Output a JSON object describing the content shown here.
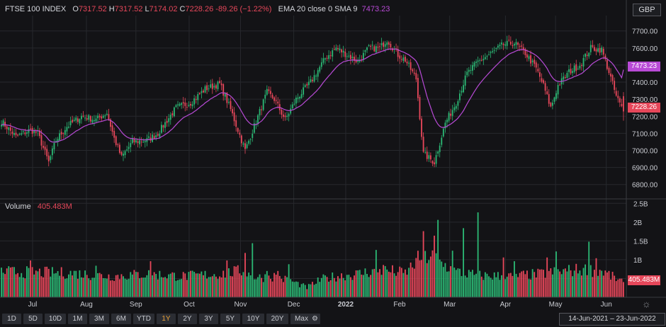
{
  "header": {
    "symbol": "FTSE 100 INDEX",
    "o_label": "O",
    "o_value": "7317.52",
    "h_label": "H",
    "h_value": "7317.52",
    "l_label": "L",
    "l_value": "7174.02",
    "c_label": "C",
    "c_value": "7228.26",
    "change": "-89.26 (−1.22%)",
    "indicator_label": "EMA 20 close 0 SMA 9",
    "indicator_value": "7473.23"
  },
  "currency": "GBP",
  "price_tags": {
    "ema": "7473.23",
    "close": "7228.26"
  },
  "volume_legend": {
    "label": "Volume",
    "value": "405.483M"
  },
  "volume_tag": "405.483M",
  "toolbar": {
    "buttons": [
      "1D",
      "5D",
      "10D",
      "1M",
      "3M",
      "6M",
      "YTD",
      "1Y",
      "2Y",
      "3Y",
      "5Y",
      "10Y",
      "20Y",
      "Max"
    ],
    "active": "1Y",
    "settings_icon": "gear-icon",
    "date_range": "14-Jun-2021  –  23-Jun-2022"
  },
  "settings_corner_icon": "sun-gear-icon",
  "colors": {
    "up": "#2bb673",
    "down": "#e6475a",
    "ema": "#b84ad6",
    "background": "#131316",
    "grid": "#27282d"
  },
  "chart_data": {
    "type": "candlestick",
    "price_axis": {
      "ticks": [
        "6800.00",
        "6900.00",
        "7000.00",
        "7100.00",
        "7200.00",
        "7300.00",
        "7400.00",
        "7500.00",
        "7600.00",
        "7700.00"
      ],
      "ylim": [
        6720,
        7790
      ]
    },
    "volume_axis": {
      "ticks": [
        "500M",
        "1B",
        "1.5B",
        "2B",
        "2.5B"
      ],
      "ylim": [
        0,
        2600
      ]
    },
    "x_labels": [
      {
        "label": "Jul",
        "t": 0.052
      },
      {
        "label": "Aug",
        "t": 0.138
      },
      {
        "label": "Sep",
        "t": 0.217
      },
      {
        "label": "Oct",
        "t": 0.302
      },
      {
        "label": "Nov",
        "t": 0.384
      },
      {
        "label": "Dec",
        "t": 0.469
      },
      {
        "label": "2022",
        "t": 0.552
      },
      {
        "label": "Feb",
        "t": 0.638
      },
      {
        "label": "Mar",
        "t": 0.718
      },
      {
        "label": "Apr",
        "t": 0.807
      },
      {
        "label": "May",
        "t": 0.887
      },
      {
        "label": "Jun",
        "t": 0.968
      }
    ],
    "close_keypoints": [
      [
        0,
        7170
      ],
      [
        8,
        7080
      ],
      [
        16,
        7120
      ],
      [
        20,
        7100
      ],
      [
        26,
        6930
      ],
      [
        30,
        7060
      ],
      [
        36,
        7140
      ],
      [
        44,
        7200
      ],
      [
        52,
        7180
      ],
      [
        58,
        7220
      ],
      [
        62,
        7070
      ],
      [
        66,
        6960
      ],
      [
        72,
        7050
      ],
      [
        80,
        7060
      ],
      [
        86,
        7100
      ],
      [
        96,
        7250
      ],
      [
        104,
        7280
      ],
      [
        112,
        7360
      ],
      [
        120,
        7390
      ],
      [
        126,
        7240
      ],
      [
        134,
        7000
      ],
      [
        140,
        7170
      ],
      [
        146,
        7340
      ],
      [
        150,
        7300
      ],
      [
        156,
        7180
      ],
      [
        162,
        7300
      ],
      [
        170,
        7400
      ],
      [
        178,
        7540
      ],
      [
        184,
        7600
      ],
      [
        190,
        7560
      ],
      [
        196,
        7520
      ],
      [
        202,
        7600
      ],
      [
        208,
        7600
      ],
      [
        212,
        7650
      ],
      [
        218,
        7560
      ],
      [
        222,
        7530
      ],
      [
        228,
        7420
      ],
      [
        232,
        6980
      ],
      [
        238,
        6930
      ],
      [
        244,
        7160
      ],
      [
        250,
        7280
      ],
      [
        256,
        7450
      ],
      [
        262,
        7520
      ],
      [
        268,
        7560
      ],
      [
        276,
        7620
      ],
      [
        282,
        7630
      ],
      [
        288,
        7570
      ],
      [
        294,
        7480
      ],
      [
        298,
        7380
      ],
      [
        302,
        7250
      ],
      [
        306,
        7380
      ],
      [
        312,
        7460
      ],
      [
        318,
        7500
      ],
      [
        324,
        7600
      ],
      [
        330,
        7590
      ],
      [
        334,
        7460
      ],
      [
        338,
        7317
      ],
      [
        342,
        7228
      ]
    ],
    "volume_keypoints": [
      [
        0,
        680
      ],
      [
        20,
        660
      ],
      [
        40,
        640
      ],
      [
        60,
        560
      ],
      [
        80,
        620
      ],
      [
        100,
        560
      ],
      [
        120,
        620
      ],
      [
        132,
        700
      ],
      [
        140,
        520
      ],
      [
        150,
        560
      ],
      [
        160,
        420
      ],
      [
        168,
        260
      ],
      [
        176,
        480
      ],
      [
        184,
        560
      ],
      [
        196,
        620
      ],
      [
        206,
        720
      ],
      [
        214,
        700
      ],
      [
        222,
        640
      ],
      [
        230,
        1050
      ],
      [
        236,
        1100
      ],
      [
        242,
        900
      ],
      [
        250,
        680
      ],
      [
        262,
        580
      ],
      [
        280,
        560
      ],
      [
        296,
        620
      ],
      [
        310,
        700
      ],
      [
        320,
        740
      ],
      [
        330,
        700
      ],
      [
        340,
        440
      ]
    ],
    "volume_spikes": [
      [
        16,
        980
      ],
      [
        52,
        840
      ],
      [
        82,
        960
      ],
      [
        124,
        980
      ],
      [
        134,
        1180
      ],
      [
        138,
        1440
      ],
      [
        146,
        700
      ],
      [
        152,
        700
      ],
      [
        158,
        880
      ],
      [
        206,
        1260
      ],
      [
        210,
        860
      ],
      [
        232,
        1760
      ],
      [
        238,
        1640
      ],
      [
        240,
        2060
      ],
      [
        248,
        1240
      ],
      [
        254,
        1840
      ],
      [
        262,
        2260
      ],
      [
        276,
        1060
      ],
      [
        282,
        960
      ],
      [
        300,
        1060
      ],
      [
        305,
        1220
      ],
      [
        323,
        1480
      ],
      [
        327,
        1040
      ]
    ],
    "series": [
      {
        "name": "FTSE 100 INDEX",
        "kind": "candles"
      },
      {
        "name": "EMA 20 close 0 SMA 9",
        "kind": "line"
      },
      {
        "name": "Volume",
        "kind": "bars"
      }
    ]
  }
}
